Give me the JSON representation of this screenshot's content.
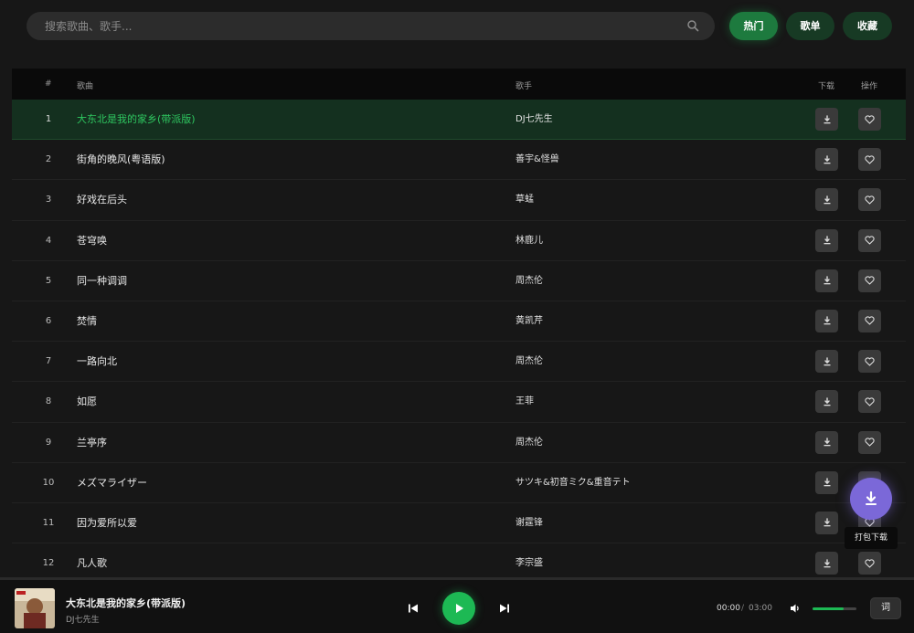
{
  "search": {
    "placeholder": "搜索歌曲、歌手..."
  },
  "nav": {
    "hot": "热门",
    "playlist": "歌单",
    "favorites": "收藏"
  },
  "table": {
    "headers": {
      "index": "#",
      "song": "歌曲",
      "artist": "歌手",
      "download": "下载",
      "action": "操作"
    },
    "rows": [
      {
        "index": "1",
        "title": "大东北是我的家乡(带派版)",
        "artist": "DJ七先生",
        "playing": true
      },
      {
        "index": "2",
        "title": "街角的晚风(粤语版)",
        "artist": "善宇&怪兽"
      },
      {
        "index": "3",
        "title": "好戏在后头",
        "artist": "草蜢"
      },
      {
        "index": "4",
        "title": "苍穹唤",
        "artist": "林鹿儿"
      },
      {
        "index": "5",
        "title": "同一种调调",
        "artist": "周杰伦"
      },
      {
        "index": "6",
        "title": "焚情",
        "artist": "黄凯芹"
      },
      {
        "index": "7",
        "title": "一路向北",
        "artist": "周杰伦"
      },
      {
        "index": "8",
        "title": "如愿",
        "artist": "王菲"
      },
      {
        "index": "9",
        "title": "兰亭序",
        "artist": "周杰伦"
      },
      {
        "index": "10",
        "title": "メズマライザー",
        "artist": "サツキ&初音ミク&重音テト"
      },
      {
        "index": "11",
        "title": "因为爱所以爱",
        "artist": "谢霆锋"
      },
      {
        "index": "12",
        "title": "凡人歌",
        "artist": "李宗盛"
      }
    ]
  },
  "fab": {
    "tooltip": "打包下载",
    "color": "#7b68d8"
  },
  "player": {
    "title": "大东北是我的家乡(带派版)",
    "artist": "DJ七先生",
    "current_time": "00:00",
    "separator": "/",
    "total_time": "03:00",
    "volume": 0.7,
    "lyric_label": "词"
  },
  "colors": {
    "accent": "#1db954",
    "background": "#171717"
  }
}
